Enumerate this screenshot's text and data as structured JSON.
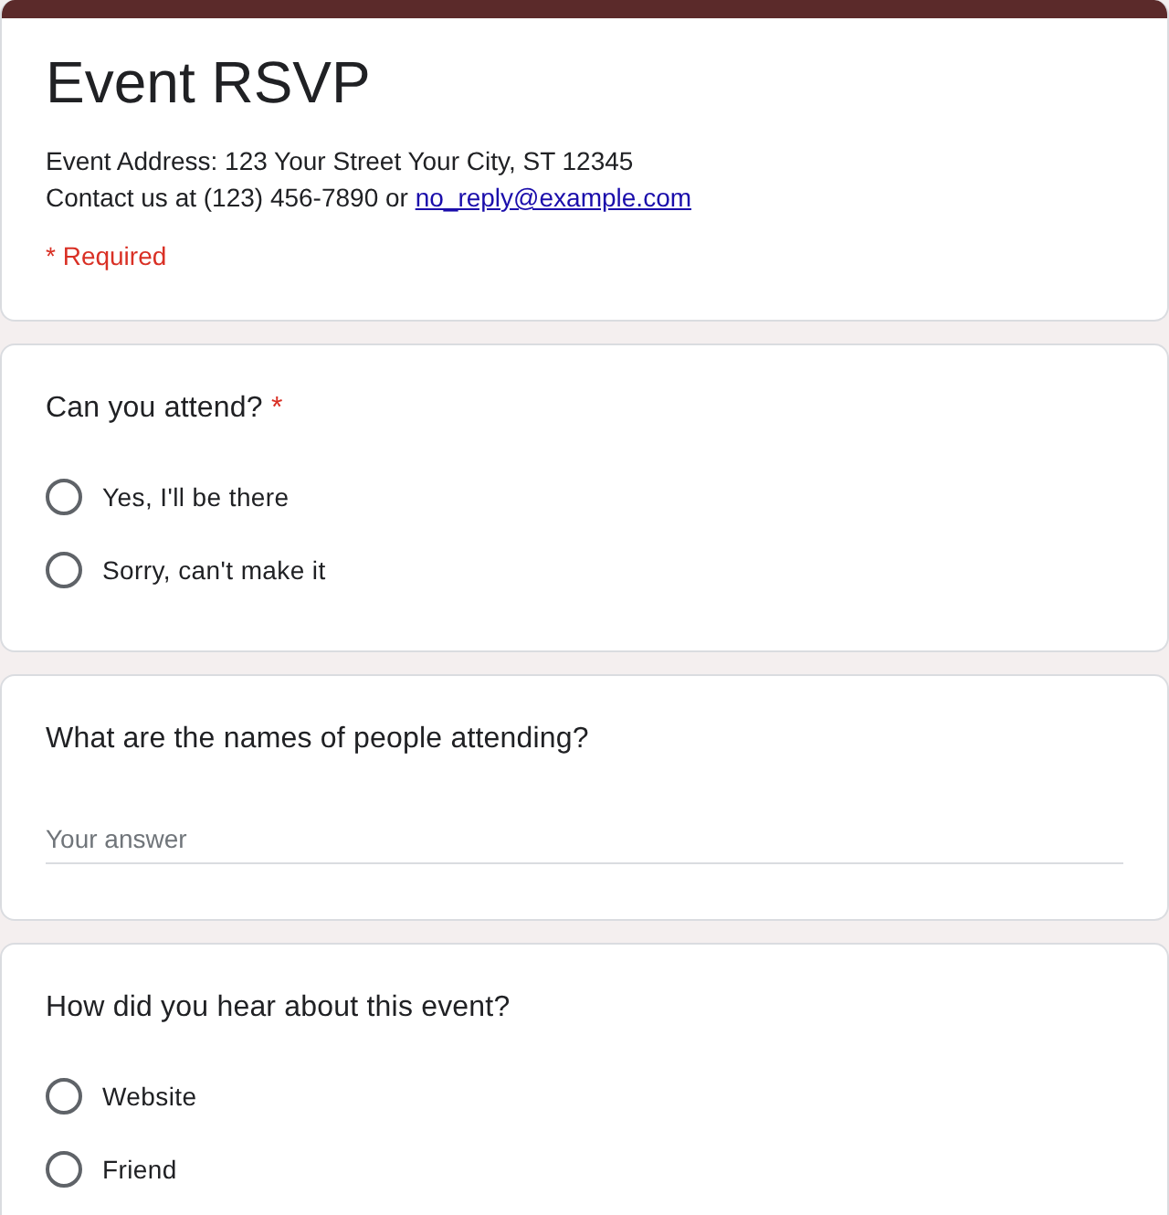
{
  "form": {
    "title": "Event RSVP",
    "description": [
      {
        "text": "Event Address: 123 Your Street Your City, ST 12345"
      },
      {
        "text": "Contact us at (123) 456-7890 or ",
        "link": "no_reply@example.com"
      }
    ],
    "required_note": "* Required"
  },
  "questions": [
    {
      "kind": "radio",
      "title": "Can you attend?",
      "required_mark": "*",
      "options": [
        {
          "label": "Yes, I'll be there",
          "selected": false
        },
        {
          "label": "Sorry, can't make it",
          "selected": false
        }
      ]
    },
    {
      "kind": "text",
      "title": "What are the names of people attending?",
      "placeholder": "Your answer"
    },
    {
      "kind": "radio",
      "title": "How did you hear about this event?",
      "options": [
        {
          "label": "Website",
          "selected": false
        },
        {
          "label": "Friend",
          "selected": false
        }
      ]
    }
  ]
}
